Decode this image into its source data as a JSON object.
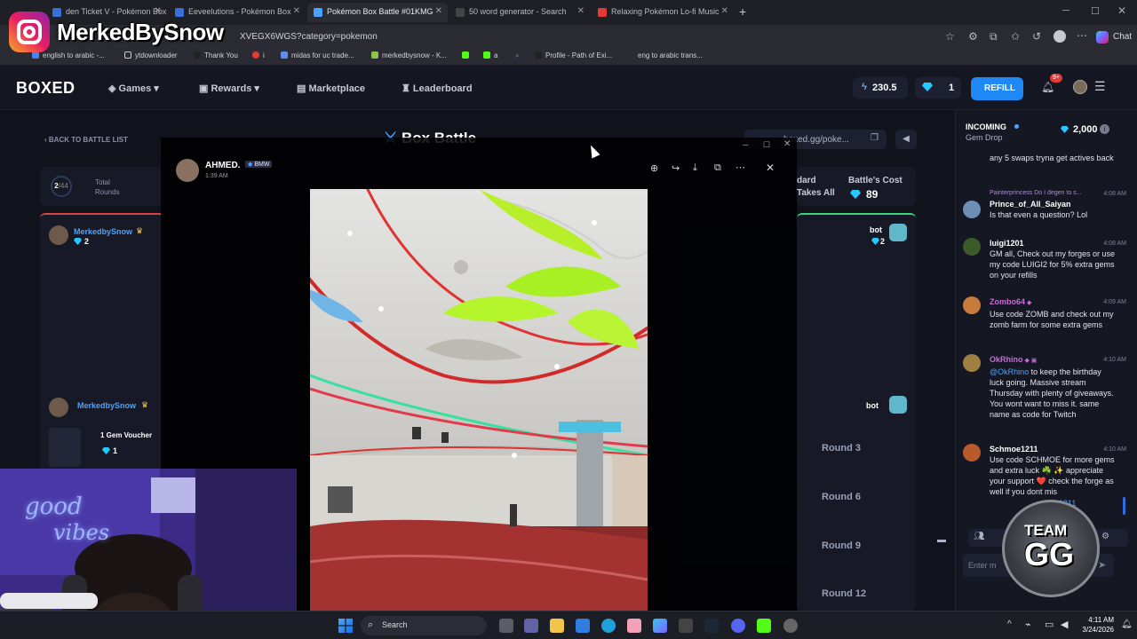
{
  "browser": {
    "tabs": [
      {
        "label": "den Ticket V - Pokémon Box",
        "active": false
      },
      {
        "label": "Eeveelutions - Pokémon Box",
        "active": false
      },
      {
        "label": "Pokémon Box Battle #01KMG",
        "active": true
      },
      {
        "label": "50 word generator - Search",
        "active": false
      },
      {
        "label": "Relaxing Pokémon Lo-fi Music",
        "active": false
      }
    ],
    "url": "XVEGX6WGS?category=pokemon",
    "chat_label": "Chat",
    "favorites": [
      "english to arabic -...",
      "ytdownloader",
      "Thank You",
      "i",
      "midas for uc trade...",
      "merkedbysnow - K...",
      "a",
      "Profile - Path of Exi...",
      "eng to arabic trans..."
    ]
  },
  "overlay_channel": "MerkedBySnow",
  "site": {
    "brand": "BOXED",
    "nav": [
      "Games",
      "Rewards",
      "Marketplace",
      "Leaderboard"
    ],
    "balance": "230.5",
    "gems": "1",
    "refill_label": "REFILL",
    "notif_count": "9+"
  },
  "battle": {
    "back_label": "BACK TO BATTLE LIST",
    "title": "Box Battle",
    "share_url": "boxed.gg/poke...",
    "round_current": "2",
    "round_total": "44",
    "total_rounds_label": "Total Rounds",
    "mode_partial": "dard",
    "mode_sub": "Takes All",
    "cost_label": "Battle's Cost",
    "cost_value": "89",
    "player1_name": "MerkedbySnow",
    "player1_gems": "2",
    "player2_name": "bot",
    "player2_gems": "2",
    "player_row_name": "MerkedbySnow",
    "bot_row_name": "bot",
    "voucher_label": "1 Gem Voucher",
    "voucher_value": "1",
    "rounds": [
      "Round 3",
      "Round 6",
      "Round 9",
      "Round 12"
    ]
  },
  "chat": {
    "incoming_label": "INCOMING",
    "gem_drop_label": "Gem Drop",
    "gem_drop_value": "2,000",
    "messages": [
      {
        "user": "",
        "time": "",
        "text": "any 5 swaps tryna get actives back"
      },
      {
        "user": "Prince_of_All_Saiyan",
        "time": "4:08 AM",
        "reply": "Painterprincess Do I degen to s...",
        "text": "Is that even a question? Lol"
      },
      {
        "user": "luigi1201",
        "time": "4:08 AM",
        "text": "GM all, Check out my forges or use my code LUIGI2 for 5% extra gems on your refills"
      },
      {
        "user": "Zombo64",
        "time": "4:09 AM",
        "text": "Use code ZOMB and check out my zomb farm for some extra gems"
      },
      {
        "user": "OkRhino",
        "time": "4:10 AM",
        "mention": "@OkRhino",
        "text": "to keep the birthday luck going. Massive stream Thursday with plenty of giveaways. You wont want to miss it. same name as code for Twitch"
      },
      {
        "user": "Schmoe1211",
        "time": "4:10 AM",
        "text": "Use code SCHMOE for more gems and extra luck ☘️ ✨ appreciate your support ❤️ check the forge as well if you dont mis"
      },
      {
        "user": "",
        "time": "",
        "text": "1211"
      }
    ],
    "input_placeholder": "Enter m"
  },
  "discord": {
    "author": "AHMED.",
    "tag": "BMW",
    "time": "1:39 AM",
    "toolbar": [
      "zoom-in-icon",
      "forward-icon",
      "download-icon",
      "open-external-icon",
      "more-icon",
      "close-icon"
    ]
  },
  "taskbar": {
    "search_label": "Search",
    "time": "4:11 AM",
    "date": "3/24/2026"
  },
  "team_badge": {
    "line1": "TEAM",
    "line2": "GG"
  },
  "webcam": {
    "neon_line1": "good",
    "neon_line2": "vibes"
  }
}
